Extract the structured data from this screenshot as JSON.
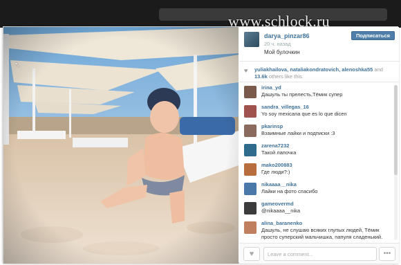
{
  "watermark": "www.schlock.ru",
  "post": {
    "username": "darya_pinzar86",
    "time_ago": "20 ч. назад",
    "caption": "Мой булочкин",
    "follow_label": "Подписаться"
  },
  "likes": {
    "names": "yuliakhailova, nataliakondratovich, alenoshka55",
    "and_label": "and",
    "count": "13.6k",
    "rest": "others like this."
  },
  "comments": [
    {
      "user": "irina_yd",
      "text": "Дашуль ты прелесть,Тёмик супер",
      "avatar_color": "#7a5a4a"
    },
    {
      "user": "sandra_villegas_16",
      "text": "Yo soy mexicana que es lo que dicen",
      "avatar_color": "#a0524f"
    },
    {
      "user": "pkarinsp",
      "text": "Взаимные лайки и подписки :3",
      "avatar_color": "#8a6a5c"
    },
    {
      "user": "zarena7232",
      "text": "Такой лапочка",
      "avatar_color": "#2f6b8c"
    },
    {
      "user": "mako200883",
      "text": "Где люди?:)",
      "avatar_color": "#b86d3f"
    },
    {
      "user": "nikaaaa__nika",
      "text": "Лайки на фото спасибо",
      "avatar_color": "#4a78a8"
    },
    {
      "user": "gameovermd",
      "text": "@nikaaaa__nika",
      "avatar_color": "#3b3b3b"
    },
    {
      "user": "alina_baranenko",
      "text": "Дашуль, не слушаю всяких глупых людей, Тёмик просто суперский мальчишка, папуля сладенький. Растите не болейте",
      "avatar_color": "#c08060"
    }
  ],
  "footer": {
    "comment_placeholder": "Leave a comment...",
    "more_label": "•••",
    "like_icon": "♥"
  },
  "icons": {
    "heart": "♥",
    "cursor": "↖"
  }
}
